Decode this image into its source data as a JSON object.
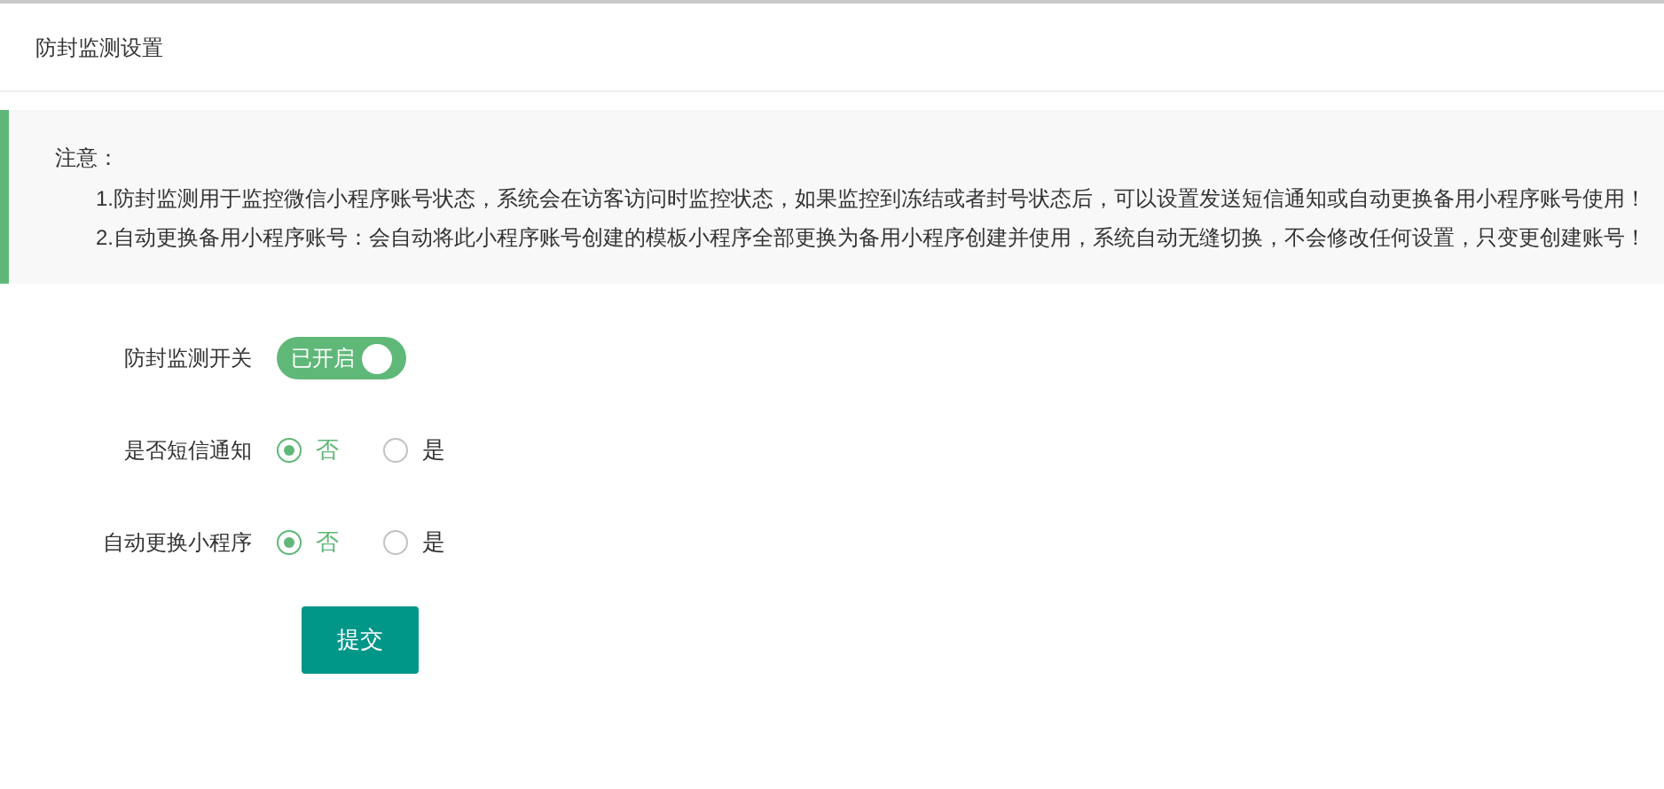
{
  "header": {
    "title": "防封监测设置"
  },
  "notice": {
    "title": "注意：",
    "items": [
      "1.防封监测用于监控微信小程序账号状态，系统会在访客访问时监控状态，如果监控到冻结或者封号状态后，可以设置发送短信通知或自动更换备用小程序账号使用！",
      "2.自动更换备用小程序账号：会自动将此小程序账号创建的模板小程序全部更换为备用小程序创建并使用，系统自动无缝切换，不会修改任何设置，只变更创建账号！"
    ]
  },
  "form": [
    {
      "kind": "switch",
      "label": "防封监测开关",
      "on": true,
      "text": "已开启"
    },
    {
      "kind": "radio",
      "label": "是否短信通知",
      "options": [
        {
          "label": "否",
          "selected": true
        },
        {
          "label": "是",
          "selected": false
        }
      ]
    },
    {
      "kind": "radio",
      "label": "自动更换小程序",
      "options": [
        {
          "label": "否",
          "selected": true
        },
        {
          "label": "是",
          "selected": false
        }
      ]
    }
  ],
  "submit": "提交"
}
